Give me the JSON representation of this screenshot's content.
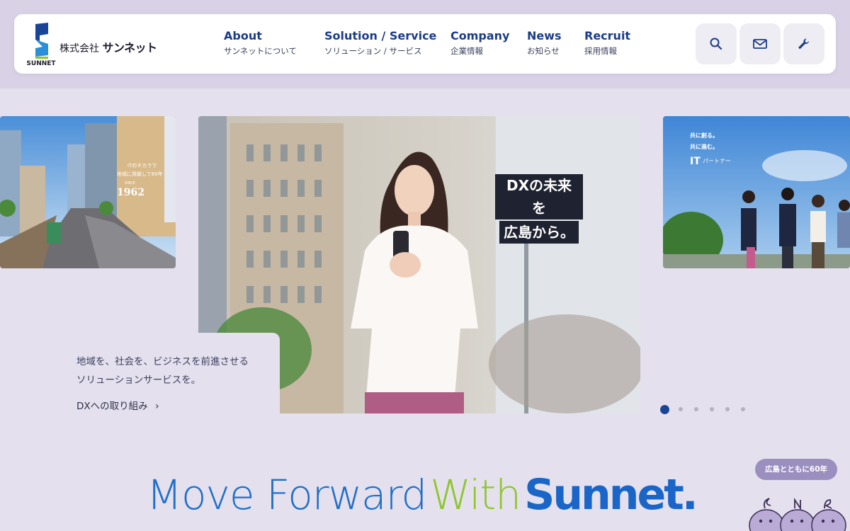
{
  "header": {
    "logo": {
      "wordmark": "SUNNET",
      "company_prefix": "株式会社",
      "company_name": "サンネット"
    },
    "nav": [
      {
        "en": "About",
        "ja": "サンネットについて"
      },
      {
        "en": "Solution / Service",
        "ja": "ソリューション / サービス"
      },
      {
        "en": "Company",
        "ja": "企業情報"
      },
      {
        "en": "News",
        "ja": "お知らせ"
      },
      {
        "en": "Recruit",
        "ja": "採用情報"
      }
    ],
    "buttons": [
      "search-icon",
      "mail-icon",
      "wrench-icon"
    ]
  },
  "hero": {
    "left_slide": {
      "line1": "ITのチカラで",
      "line2": "地域に貢献して60年",
      "since": "SINCE",
      "year": "1962"
    },
    "main_slide": {
      "heading_line1": "DXの未来を",
      "heading_line2": "広島から。"
    },
    "right_slide": {
      "line1": "共に創る。",
      "line2": "共に進む。",
      "it": "IT",
      "partner": "パートナー"
    },
    "caption": {
      "line1": "地域を、社会を、ビジネスを前進させる",
      "line2": "ソリューションサービスを。",
      "link": "DXへの取り組み"
    },
    "dots": {
      "count": 6,
      "active": 1
    }
  },
  "tagline": {
    "word1": "Move Forward",
    "word2": "With",
    "word3": "Sunnet."
  },
  "mascot": {
    "bubble": "広島とともに60年"
  },
  "colors": {
    "brand_navy": "#1c3c87",
    "brand_blue": "#1a66c8",
    "brand_green": "#8dc629",
    "background": "#e5e0ee",
    "bubble": "#9b8fc0"
  }
}
